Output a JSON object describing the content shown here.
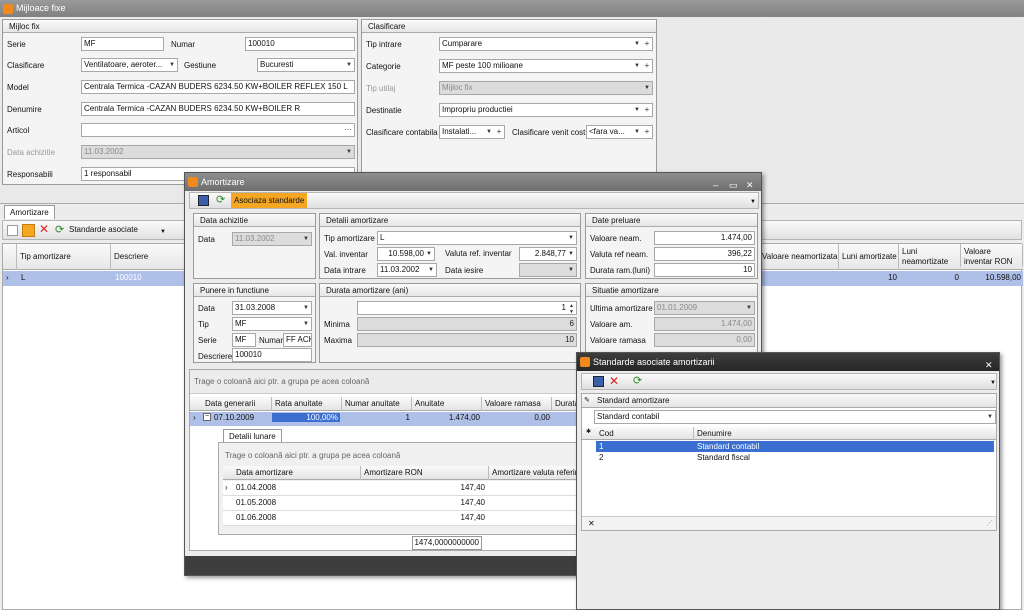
{
  "main": {
    "title": "Mijloace fixe",
    "mijloc": {
      "header": "Mijloc fix",
      "serie_l": "Serie",
      "serie_v": "MF",
      "numar_l": "Numar",
      "numar_v": "100010",
      "clasif_l": "Clasificare",
      "clasif_v": "Ventilatoare, aeroter...",
      "gest_l": "Gestiune",
      "gest_v": "Bucuresti",
      "model_l": "Model",
      "model_v": "Centrala Termica -CAZAN BUDERS 6234.50 KW+BOILER REFLEX 150 L",
      "den_l": "Denumire",
      "den_v": "Centrala Termica -CAZAN BUDERS 6234.50 KW+BOILER R",
      "art_l": "Articol",
      "art_v": "",
      "dach_l": "Data achizitie",
      "dach_v": "11.03.2002",
      "resp_l": "Responsabili",
      "resp_v": "1 responsabil"
    },
    "clasif": {
      "header": "Clasificare",
      "tip_l": "Tip intrare",
      "tip_v": "Cumparare",
      "cat_l": "Categorie",
      "cat_v": "MF peste 100 milioane",
      "util_l": "Tip utilaj",
      "util_v": "Mijloc fix",
      "dest_l": "Destinatie",
      "dest_v": "Impropriu productiei",
      "cc_l": "Clasificare contabila",
      "cc_v": "Instalati...",
      "cvc_l": "Clasificare venit cost",
      "cvc_v": "<fara va..."
    },
    "tab": "Amortizare",
    "toolbar_label": "Standarde asociate",
    "grid": {
      "cols": [
        "Tip amortizare",
        "Descriere"
      ],
      "row": [
        "L",
        "100010"
      ],
      "rcols": [
        "Valoare neamortizata",
        "Luni amortizate",
        "Luni neamortizate",
        "Valoare inventar RON"
      ],
      "rrow": [
        "10",
        "0",
        "10.598,00"
      ]
    }
  },
  "amort": {
    "title": "Amortizare",
    "toolbar_label": "Asociaza standarde",
    "dach": {
      "header": "Data achizitie",
      "data_l": "Data",
      "data_v": "11.03.2002"
    },
    "det": {
      "header": "Detalii amortizare",
      "tip_l": "Tip amortizare",
      "tip_v": "L",
      "vinv_l": "Val. inventar",
      "vinv_v": "10.598,00",
      "vref_l": "Valuta  ref. inventar",
      "vref_v": "2.848,77",
      "dint_l": "Data intrare",
      "dint_v": "11.03.2002",
      "dies_l": "Data iesire",
      "dies_v": ""
    },
    "prel": {
      "header": "Date preluare",
      "vneam_l": "Valoare neam.",
      "vneam_v": "1.474,00",
      "vref_l": "Valuta ref neam.",
      "vref_v": "396,22",
      "dur_l": "Durata ram.(luni)",
      "dur_v": "10"
    },
    "pun": {
      "header": "Punere in functiune",
      "data_l": "Data",
      "data_v": "31.03.2008",
      "tip_l": "Tip",
      "tip_v": "MF",
      "serie_l": "Serie",
      "serie_v": "MF",
      "num_l": "Numar",
      "num_v": "FF ACK",
      "desc_l": "Descriere",
      "desc_v": "100010"
    },
    "dur": {
      "header": "Durata amortizare (ani)",
      "val": "1",
      "min_l": "Minima",
      "min_v": "6",
      "max_l": "Maxima",
      "max_v": "10"
    },
    "sit": {
      "header": "Situatie amortizare",
      "ult_l": "Ultima amortizare",
      "ult_v": "01.01.2009",
      "vam_l": "Valoare am.",
      "vam_v": "1.474,00",
      "vram_l": "Valoare ramasa",
      "vram_v": "0,00"
    },
    "group_hint": "Trage o coloană aici ptr. a grupa pe acea coloană",
    "grid": {
      "cols": [
        "Data generarii",
        "Rata anuitate",
        "Numar anuitate",
        "Anuitate",
        "Valoare ramasa",
        "Durata r"
      ],
      "row": [
        "07.10.2009",
        "100,00%",
        "1",
        "1.474,00",
        "0,00"
      ]
    },
    "detail": {
      "tab": "Detalii lunare",
      "hint": "Trage o coloană aici ptr. a grupa pe acea coloană",
      "cols": [
        "Data amortizare",
        "Amortizare RON",
        "Amortizare valuta referinta"
      ],
      "rows": [
        [
          "01.04.2008",
          "147,40"
        ],
        [
          "01.05.2008",
          "147,40"
        ],
        [
          "01.06.2008",
          "147,40"
        ]
      ],
      "total": "1474,0000000000"
    }
  },
  "std": {
    "title": "Standarde asociate amortizarii",
    "group": "Standard amortizare",
    "selected": "Standard contabil",
    "cols": [
      "Cod",
      "Denumire"
    ],
    "rows": [
      [
        "1",
        "Standard contabil"
      ],
      [
        "2",
        "Standard fiscal"
      ]
    ]
  },
  "colors": {
    "accent": "#f5a623",
    "sel": "#3a6fd0",
    "rowsel": "#aebfe8"
  }
}
